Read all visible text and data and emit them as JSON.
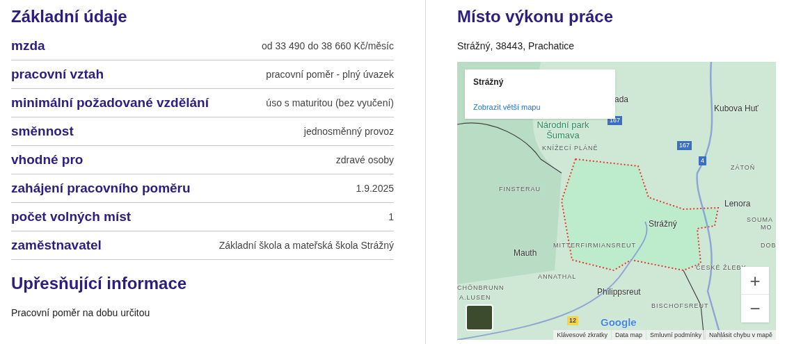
{
  "basic": {
    "title": "Základní údaje",
    "rows": [
      {
        "label": "mzda",
        "value": "od 33 490 do 38 660 Kč/měsíc"
      },
      {
        "label": "pracovní vztah",
        "value": "pracovní poměr - plný úvazek"
      },
      {
        "label": "minimální požadované vzdělání",
        "value": "úso s maturitou (bez vyučení)"
      },
      {
        "label": "směnnost",
        "value": "jednosměnný provoz"
      },
      {
        "label": "vhodné pro",
        "value": "zdravé osoby"
      },
      {
        "label": "zahájení pracovního poměru",
        "value": "1.9.2025"
      },
      {
        "label": "počet volných míst",
        "value": "1"
      },
      {
        "label": "zaměstnavatel",
        "value": "Základní škola a mateřská škola Strážný"
      }
    ]
  },
  "details": {
    "title": "Upřesňující informace",
    "text": "Pracovní poměr na dobu určitou"
  },
  "location": {
    "title": "Místo výkonu práce",
    "address": "Strážný, 38443, Prachatice",
    "map": {
      "popup": {
        "title": "Strážný",
        "link": "Zobrazit větší mapu"
      },
      "labels": [
        {
          "kind": "place",
          "text": "ada"
        },
        {
          "kind": "place",
          "text": "Kubova Huť"
        },
        {
          "kind": "park",
          "text": "Národní park Šumava"
        },
        {
          "kind": "road_cz",
          "text": "167"
        },
        {
          "kind": "road_cz",
          "text": "167"
        },
        {
          "kind": "road_cz",
          "text": "4"
        },
        {
          "kind": "district",
          "text": "KNÍŽECÍ PLÁNĚ"
        },
        {
          "kind": "district",
          "text": "ZÁTOŇ"
        },
        {
          "kind": "district",
          "text": "FINSTERAU"
        },
        {
          "kind": "place",
          "text": "Lenora"
        },
        {
          "kind": "district",
          "text": "SOUMA"
        },
        {
          "kind": "district",
          "text": "MO"
        },
        {
          "kind": "place",
          "text": "Strážný"
        },
        {
          "kind": "district",
          "text": "DOB"
        },
        {
          "kind": "district",
          "text": "MITTERFIRMIANSREUT"
        },
        {
          "kind": "place",
          "text": "Mauth"
        },
        {
          "kind": "district",
          "text": "ČESKÉ ŽLEBY"
        },
        {
          "kind": "district",
          "text": "ANNATHAL"
        },
        {
          "kind": "place",
          "text": "Philippsreut"
        },
        {
          "kind": "district",
          "text": "CHÖNBRUNN"
        },
        {
          "kind": "district",
          "text": "A.LUSEN"
        },
        {
          "kind": "district",
          "text": "BISCHOFSREUT"
        },
        {
          "kind": "road_de",
          "text": "12"
        }
      ],
      "zoom": {
        "in": "+",
        "out": "−"
      },
      "logo": "Google",
      "attribution": [
        "Klávesové zkratky",
        "Data map",
        "Smluvní podmínky",
        "Nahlásit chybu v mapě"
      ]
    }
  }
}
